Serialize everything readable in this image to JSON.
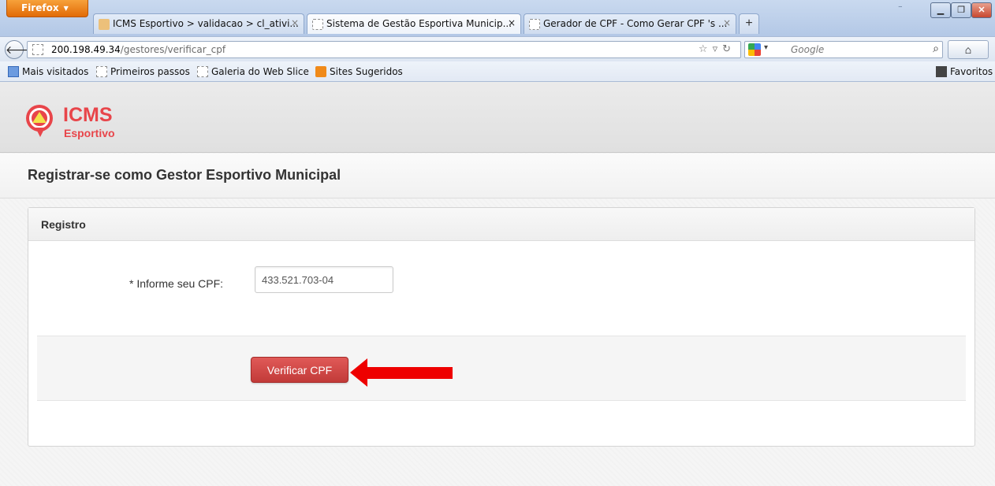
{
  "browser": {
    "menu_button": "Firefox",
    "tabs": [
      {
        "label": "ICMS Esportivo > validacao > cl_ativi..."
      },
      {
        "label": "Sistema de Gestão Esportiva Municip..."
      },
      {
        "label": "Gerador de CPF - Como Gerar CPF 's ..."
      }
    ],
    "url_host": "200.198.49.34",
    "url_path": "/gestores/verificar_cpf",
    "search_placeholder": "Google",
    "bookmarks": [
      {
        "label": "Mais visitados",
        "icon": "bookmark-blue-icon"
      },
      {
        "label": "Primeiros passos",
        "icon": "page-icon"
      },
      {
        "label": "Galeria do Web Slice",
        "icon": "page-icon"
      },
      {
        "label": "Sites Sugeridos",
        "icon": "sites-icon"
      }
    ],
    "favorites_label": "Favoritos"
  },
  "site": {
    "logo_title": "ICMS",
    "logo_subtitle": "Esportivo",
    "page_title": "Registrar-se como Gestor Esportivo Municipal"
  },
  "form": {
    "panel_title": "Registro",
    "cpf_label": "* Informe seu CPF:",
    "cpf_value": "433.521.703-04",
    "submit_label": "Verificar CPF"
  },
  "colors": {
    "brand_red": "#e8454a",
    "button_red": "#c94442",
    "arrow_red": "#ee0000"
  }
}
